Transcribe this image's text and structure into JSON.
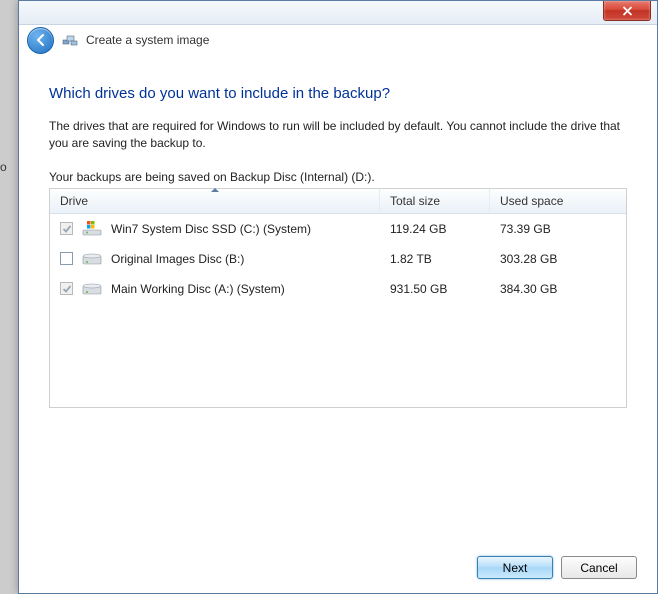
{
  "edge_fragment": "o",
  "window": {
    "title": "Create a system image"
  },
  "page": {
    "heading": "Which drives do you want to include in the backup?",
    "description": "The drives that are required for Windows to run will be included by default. You cannot include the drive that you are saving the backup to.",
    "saved_to": "Your backups are being saved on Backup Disc (Internal) (D:)."
  },
  "table": {
    "columns": {
      "drive": "Drive",
      "total": "Total size",
      "used": "Used space"
    },
    "rows": [
      {
        "checked": true,
        "disabled": true,
        "icon": "win",
        "name": "Win7 System Disc SSD (C:) (System)",
        "total": "119.24 GB",
        "used": "73.39 GB"
      },
      {
        "checked": false,
        "disabled": false,
        "icon": "hdd",
        "name": "Original Images Disc (B:)",
        "total": "1.82 TB",
        "used": "303.28 GB"
      },
      {
        "checked": true,
        "disabled": true,
        "icon": "hdd",
        "name": "Main Working Disc (A:) (System)",
        "total": "931.50 GB",
        "used": "384.30 GB"
      }
    ]
  },
  "buttons": {
    "next": "Next",
    "cancel": "Cancel"
  }
}
